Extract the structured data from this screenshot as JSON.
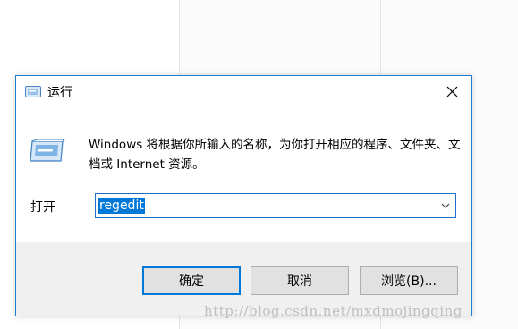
{
  "dialog": {
    "title": "运行",
    "description": "Windows 将根据你所输入的名称，为你打开相应的程序、文件夹、文档或 Internet 资源。",
    "open_label": "打开",
    "input_value": "regedit",
    "buttons": {
      "ok": "确定",
      "cancel": "取消",
      "browse": "浏览(B)..."
    },
    "icons": {
      "title": "run-icon",
      "main": "run-icon",
      "close": "close-icon",
      "dropdown": "chevron-down-icon"
    }
  },
  "watermark": "http://blog.csdn.net/mxdmojingqing",
  "colors": {
    "accent": "#0078d7",
    "dialog_border": "#1f7ed0",
    "footer_bg": "#f0f0f0",
    "button_bg": "#e1e1e1"
  }
}
